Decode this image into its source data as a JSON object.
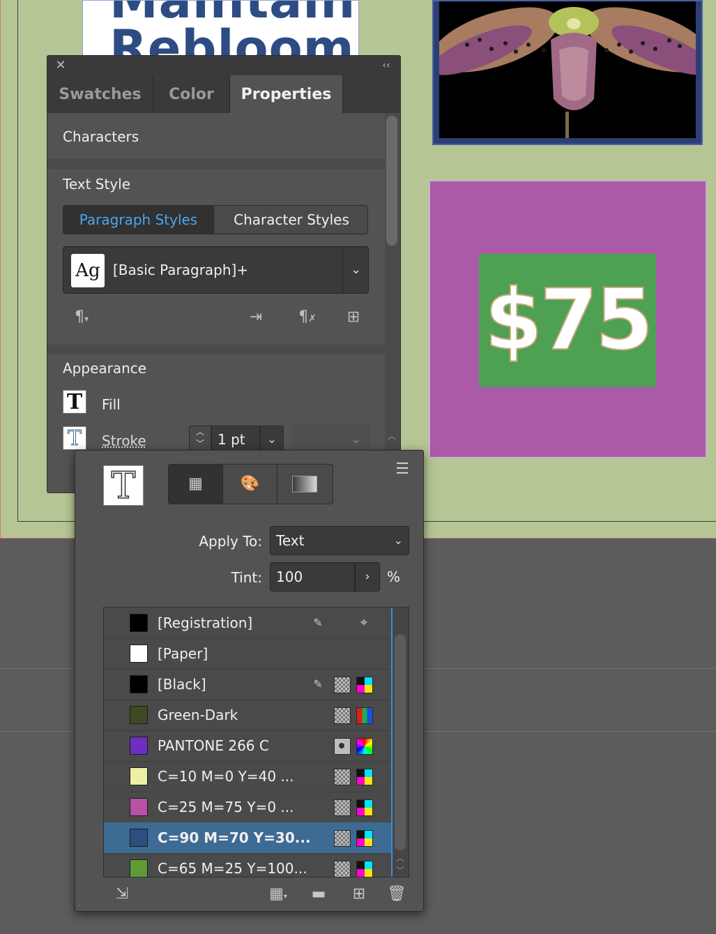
{
  "canvas": {
    "headline": "Maintain.\nRebloom.",
    "price": "$75"
  },
  "properties_panel": {
    "tabs": [
      {
        "label": "Swatches"
      },
      {
        "label": "Color"
      },
      {
        "label": "Properties"
      }
    ],
    "characters_heading": "Characters",
    "text_style_heading": "Text Style",
    "segmented": {
      "paragraph": "Paragraph Styles",
      "character": "Character Styles"
    },
    "style_dropdown": {
      "icon_text": "Ag",
      "value": "[Basic Paragraph]+"
    },
    "appearance_heading": "Appearance",
    "fill_label": "Fill",
    "stroke_label": "Stroke",
    "stroke_weight": "1 pt"
  },
  "swatch_popover": {
    "apply_to_label": "Apply To:",
    "apply_to_value": "Text",
    "tint_label": "Tint:",
    "tint_value": "100",
    "tint_unit": "%",
    "swatches": [
      {
        "name": "[Registration]",
        "color": "#000000"
      },
      {
        "name": "[Paper]",
        "color": "#ffffff"
      },
      {
        "name": "[Black]",
        "color": "#000000"
      },
      {
        "name": "Green-Dark",
        "color": "#3f4a22"
      },
      {
        "name": "PANTONE 266 C",
        "color": "#6d2fbf"
      },
      {
        "name": "C=10 M=0 Y=40 ...",
        "color": "#ecf0a6"
      },
      {
        "name": "C=25 M=75 Y=0 ...",
        "color": "#b752a6"
      },
      {
        "name": "C=90 M=70 Y=30...",
        "color": "#2d4f80"
      },
      {
        "name": "C=65 M=25 Y=100...",
        "color": "#5e9a3a"
      }
    ]
  }
}
